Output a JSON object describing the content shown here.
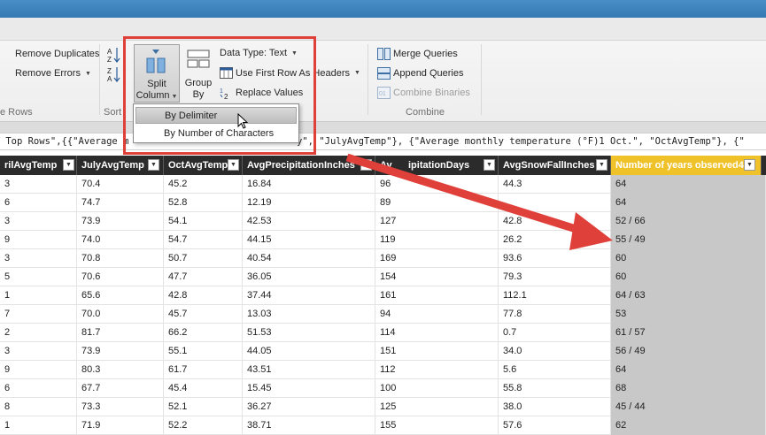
{
  "ribbon": {
    "remove_duplicates": "Remove Duplicates",
    "remove_errors": "Remove Errors",
    "reduce_rows_label": "e Rows",
    "sort_label": "Sort",
    "split_column_line1": "Split",
    "split_column_line2": "Column",
    "group_by_line1": "Group",
    "group_by_line2": "By",
    "data_type": "Data Type: Text",
    "use_first_row": "Use First Row As Headers",
    "replace_values": "Replace Values",
    "merge_queries": "Merge Queries",
    "append_queries": "Append Queries",
    "combine_binaries": "Combine Binaries",
    "combine_label": "Combine"
  },
  "split_menu": {
    "by_delimiter": "By Delimiter",
    "by_number_of_characters": "By Number of Characters"
  },
  "formula": " Top Rows\",{{\"Average m                              y\", \"JulyAvgTemp\"}, {\"Average monthly temperature (°F)1 Oct.\", \"OctAvgTemp\"}, {\"",
  "grid": {
    "columns": [
      "rilAvgTemp",
      "JulyAvgTemp",
      "OctAvgTemp",
      "AvgPrecipitationInches",
      "AvgPrecipitationDays",
      "AvgSnowFallInches",
      "Number of years observed4"
    ],
    "header_partial_precip_days": "Av      ipitationDays",
    "rows": [
      [
        "3",
        "70.4",
        "45.2",
        "16.84",
        "96",
        "44.3",
        "64"
      ],
      [
        "6",
        "74.7",
        "52.8",
        "12.19",
        "89",
        "",
        "64"
      ],
      [
        "3",
        "73.9",
        "54.1",
        "42.53",
        "127",
        "42.8",
        "52 / 66"
      ],
      [
        "9",
        "74.0",
        "54.7",
        "44.15",
        "119",
        "26.2",
        "55 / 49"
      ],
      [
        "3",
        "70.8",
        "50.7",
        "40.54",
        "169",
        "93.6",
        "60"
      ],
      [
        "5",
        "70.6",
        "47.7",
        "36.05",
        "154",
        "79.3",
        "60"
      ],
      [
        "1",
        "65.6",
        "42.8",
        "37.44",
        "161",
        "112.1",
        "64 / 63"
      ],
      [
        "7",
        "70.0",
        "45.7",
        "13.03",
        "94",
        "77.8",
        "53"
      ],
      [
        "2",
        "81.7",
        "66.2",
        "51.53",
        "114",
        "0.7",
        "61 / 57"
      ],
      [
        "3",
        "73.9",
        "55.1",
        "44.05",
        "151",
        "34.0",
        "56 / 49"
      ],
      [
        "9",
        "80.3",
        "61.7",
        "43.51",
        "112",
        "5.6",
        "64"
      ],
      [
        "6",
        "67.7",
        "45.4",
        "15.45",
        "100",
        "55.8",
        "68"
      ],
      [
        "8",
        "73.3",
        "52.1",
        "36.27",
        "125",
        "38.0",
        "45 / 44"
      ],
      [
        "1",
        "71.9",
        "52.2",
        "38.71",
        "155",
        "57.6",
        "62"
      ]
    ]
  },
  "colors": {
    "highlight": "#e0403a",
    "selected_header": "#f0c22a",
    "arrow": "#e0403a"
  }
}
